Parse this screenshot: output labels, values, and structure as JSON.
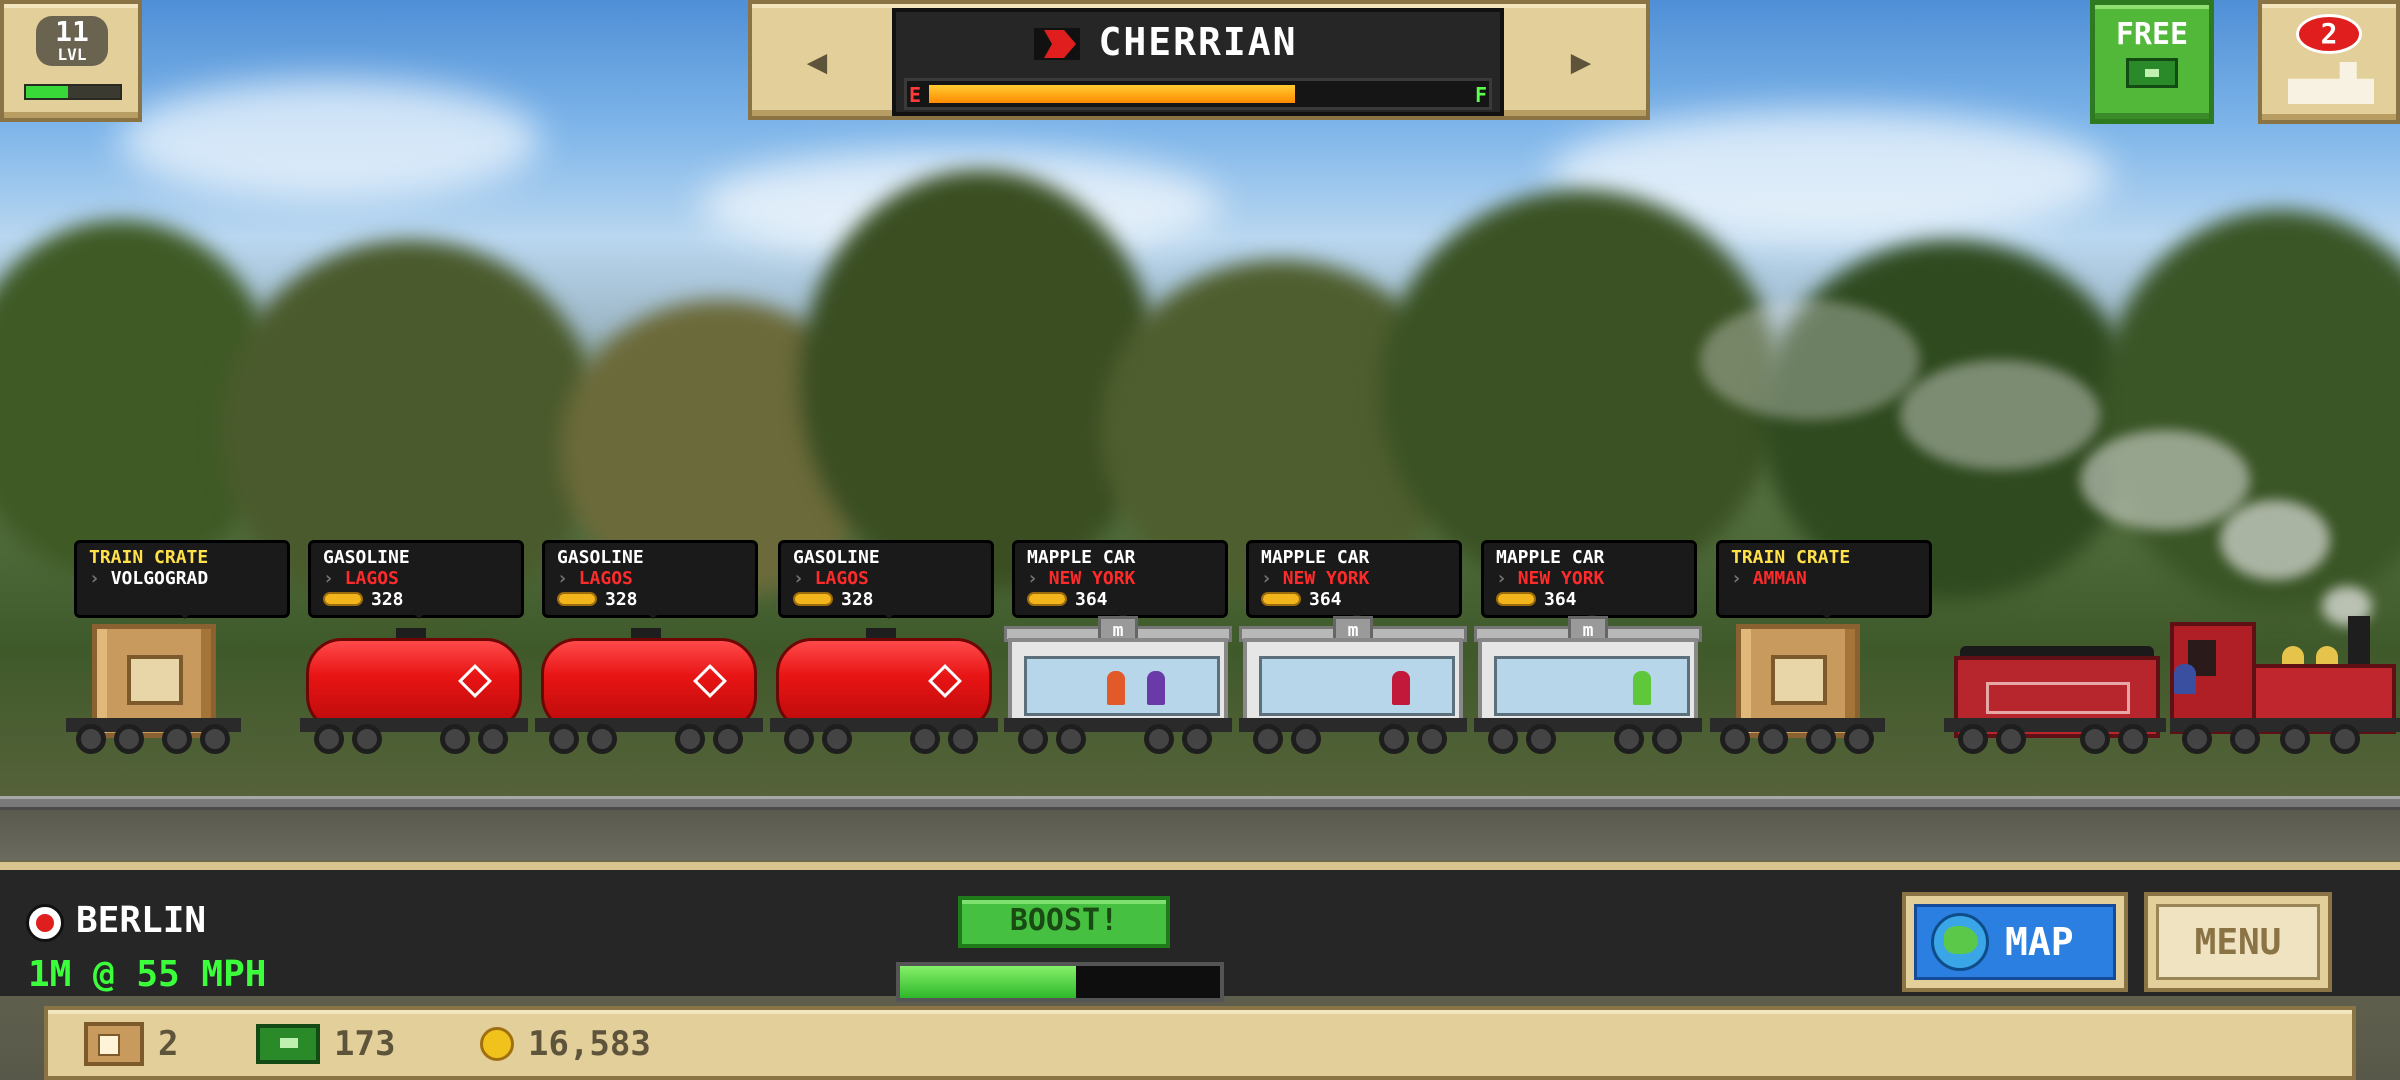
{
  "hud_top": {
    "level": {
      "value": "11",
      "label": "LVL",
      "xp_progress": 0.45
    },
    "train_name": "CHERRIAN",
    "fuel": {
      "empty_label": "E",
      "full_label": "F",
      "level": 0.68
    },
    "prev_train_icon": "chevron-left-icon",
    "next_train_icon": "chevron-right-icon",
    "free_button": {
      "label": "FREE",
      "icon": "cash-icon"
    },
    "trains_button": {
      "badge_count": "2",
      "icon": "locomotive-icon"
    }
  },
  "cars": [
    {
      "type": "crate",
      "title": "TRAIN CRATE",
      "title_color": "yellow",
      "destination": "VOLGOGRAD",
      "destination_color": "white",
      "payout": ""
    },
    {
      "type": "tank",
      "title": "GASOLINE",
      "title_color": "white",
      "destination": "LAGOS",
      "destination_color": "red",
      "payout": "328"
    },
    {
      "type": "tank",
      "title": "GASOLINE",
      "title_color": "white",
      "destination": "LAGOS",
      "destination_color": "red",
      "payout": "328"
    },
    {
      "type": "tank",
      "title": "GASOLINE",
      "title_color": "white",
      "destination": "LAGOS",
      "destination_color": "red",
      "payout": "328"
    },
    {
      "type": "mapple",
      "title": "MAPPLE CAR",
      "title_color": "white",
      "destination": "NEW YORK",
      "destination_color": "red",
      "payout": "364"
    },
    {
      "type": "mapple",
      "title": "MAPPLE CAR",
      "title_color": "white",
      "destination": "NEW YORK",
      "destination_color": "red",
      "payout": "364"
    },
    {
      "type": "mapple",
      "title": "MAPPLE CAR",
      "title_color": "white",
      "destination": "NEW YORK",
      "destination_color": "red",
      "payout": "364"
    },
    {
      "type": "crate",
      "title": "TRAIN CRATE",
      "title_color": "yellow",
      "destination": "AMMAN",
      "destination_color": "red",
      "payout": ""
    }
  ],
  "mapple_logo": "m",
  "hud_bottom": {
    "station": "BERLIN",
    "distance": "1M @ 55 MPH",
    "boost_label": "BOOST!",
    "boost_progress": 0.55,
    "map_label": "MAP",
    "menu_label": "MENU"
  },
  "resources": {
    "crates": "2",
    "cash": "173",
    "coins": "16,583"
  },
  "colors": {
    "accent_red": "#e81414",
    "tan_panel": "#e2cf9a",
    "boost_green": "#46c040",
    "map_blue": "#2b7fe0",
    "distance_green": "#3cff3c"
  }
}
